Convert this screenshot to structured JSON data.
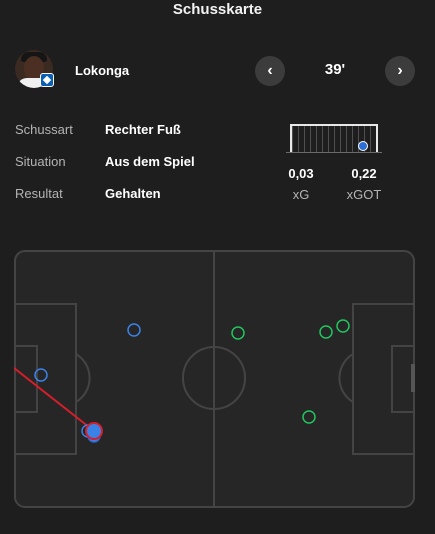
{
  "header": {
    "title": "Schusskarte"
  },
  "player": {
    "name": "Lokonga",
    "club_color": "#0a5fb5"
  },
  "navigation": {
    "prev_icon": "chevron-left-icon",
    "next_icon": "chevron-right-icon",
    "prev_label": "‹",
    "next_label": "›"
  },
  "shot": {
    "minute": "39'",
    "details": [
      {
        "label": "Schussart",
        "value": "Rechter Fuß"
      },
      {
        "label": "Situation",
        "value": "Aus dem Spiel"
      },
      {
        "label": "Resultat",
        "value": "Gehalten"
      }
    ],
    "xg": {
      "value": "0,03",
      "label": "xG"
    },
    "xgot": {
      "value": "0,22",
      "label": "xGOT"
    }
  },
  "colors": {
    "background": "#1e1e1e",
    "pitch": "#262626",
    "pitch_lines": "#444444",
    "team_shot": "#3b82e6",
    "opponent_shot": "#22c55e",
    "selected_shot": "#d41f2a"
  }
}
